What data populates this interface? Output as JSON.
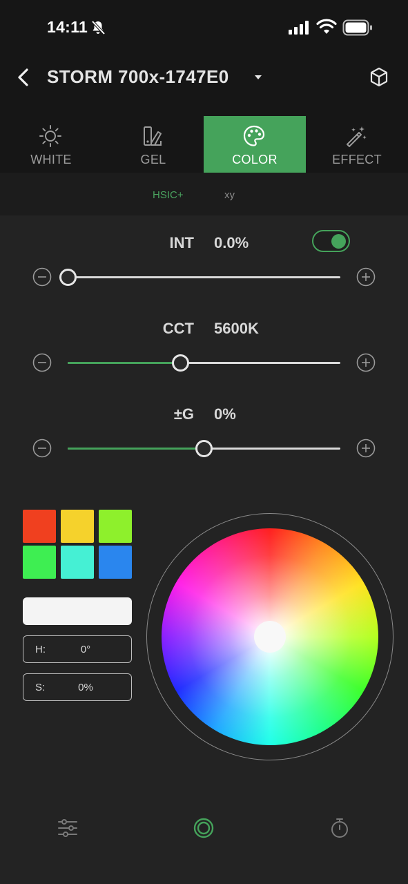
{
  "status_bar": {
    "time": "14:11"
  },
  "header": {
    "device_name": "STORM 700x-1747E0"
  },
  "tabs": [
    {
      "label": "WHITE",
      "icon": "sun-icon",
      "active": false
    },
    {
      "label": "GEL",
      "icon": "gel-swatch-icon",
      "active": false
    },
    {
      "label": "COLOR",
      "icon": "palette-icon",
      "active": true
    },
    {
      "label": "EFFECT",
      "icon": "magic-wand-icon",
      "active": false
    }
  ],
  "subtabs": {
    "hsic": "HSIC+",
    "xy": "xy",
    "active": "HSIC+"
  },
  "intensity": {
    "label": "INT",
    "value": "0.0%",
    "level": 0.0,
    "enabled": true
  },
  "cct": {
    "label": "CCT",
    "value": "5600K",
    "level": 0.415
  },
  "green": {
    "label": "±G",
    "value": "0%",
    "level": 0.5
  },
  "swatches": [
    "#f0401f",
    "#f5d22c",
    "#8ef02c",
    "#3eee52",
    "#45f0d4",
    "#2a86ee"
  ],
  "selected_color": "#f4f4f4",
  "hue": {
    "label": "H:",
    "value": "0°"
  },
  "saturation": {
    "label": "S:",
    "value": "0%"
  },
  "colors": {
    "accent": "#45a35b",
    "background": "#232323",
    "header_bg": "#161616"
  },
  "bottom_nav": [
    {
      "icon": "sliders-icon",
      "active": false
    },
    {
      "icon": "color-ring-icon",
      "active": true
    },
    {
      "icon": "timer-icon",
      "active": false
    }
  ]
}
